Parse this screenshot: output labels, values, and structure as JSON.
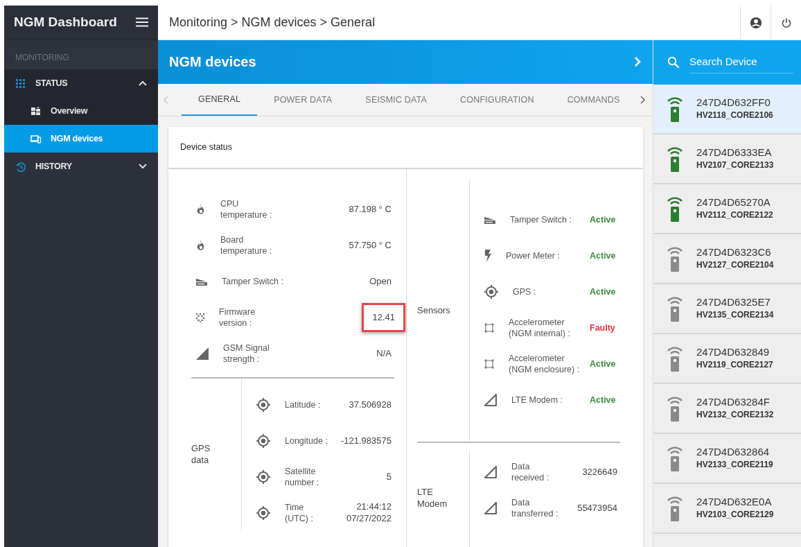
{
  "sidebar": {
    "title": "NGM Dashboard",
    "section": "MONITORING",
    "items": [
      {
        "label": "STATUS",
        "expanded": true,
        "children": [
          {
            "label": "Overview",
            "selected": false
          },
          {
            "label": "NGM devices",
            "selected": true
          }
        ]
      },
      {
        "label": "HISTORY",
        "expanded": false
      }
    ]
  },
  "breadcrumb": "Monitoring > NGM devices > General",
  "page_title": "NGM devices",
  "tabs": [
    {
      "label": "GENERAL",
      "selected": true
    },
    {
      "label": "POWER DATA",
      "selected": false
    },
    {
      "label": "SEISMIC DATA",
      "selected": false
    },
    {
      "label": "CONFIGURATION",
      "selected": false
    },
    {
      "label": "COMMANDS",
      "selected": false
    }
  ],
  "device_status": {
    "title": "Device status",
    "items": [
      {
        "label": "CPU\ntemperature :",
        "value": "87.198 ° C",
        "highlighted": false
      },
      {
        "label": "Board\ntemperature :",
        "value": "57.750 ° C",
        "highlighted": false
      },
      {
        "label": "Tamper Switch :",
        "value": "Open",
        "highlighted": false
      },
      {
        "label": "Firmware\nversion :",
        "value": "12.41",
        "highlighted": true
      },
      {
        "label": "GSM Signal\nstrength :",
        "value": "N/A",
        "highlighted": false
      }
    ],
    "gps": {
      "title": "GPS\ndata",
      "items": [
        {
          "label": "Latitude :",
          "value": "37.506928"
        },
        {
          "label": "Longitude :",
          "value": "-121.983575"
        },
        {
          "label": "Satellite\nnumber :",
          "value": "5"
        },
        {
          "label": "Time\n(UTC) :",
          "value": "21:44:12\n07/27/2022"
        }
      ]
    },
    "sensors": {
      "title": "Sensors",
      "items": [
        {
          "label": "Tamper Switch :",
          "value": "Active",
          "ok": true
        },
        {
          "label": "Power Meter :",
          "value": "Active",
          "ok": true
        },
        {
          "label": "GPS :",
          "value": "Active",
          "ok": true
        },
        {
          "label": "Accelerometer\n(NGM internal) :",
          "value": "Faulty",
          "ok": false
        },
        {
          "label": "Accelerometer\n(NGM enclosure) :",
          "value": "Active",
          "ok": true
        },
        {
          "label": "LTE Modem :",
          "value": "Active",
          "ok": true
        }
      ]
    },
    "lte": {
      "title": "LTE\nModem",
      "items": [
        {
          "label": "Data\nreceived :",
          "value": "3226649"
        },
        {
          "label": "Data\ntransferred :",
          "value": "55473954"
        }
      ]
    }
  },
  "search": {
    "placeholder": "Search Device"
  },
  "devices": [
    {
      "id": "247D4D632FF0",
      "name": "HV2118_CORE2106",
      "online": true,
      "selected": true
    },
    {
      "id": "247D4D6333EA",
      "name": "HV2107_CORE2133",
      "online": true,
      "selected": false
    },
    {
      "id": "247D4D65270A",
      "name": "HV2112_CORE2122",
      "online": true,
      "selected": false
    },
    {
      "id": "247D4D6323C6",
      "name": "HV2127_CORE2104",
      "online": false,
      "selected": false
    },
    {
      "id": "247D4D6325E7",
      "name": "HV2135_CORE2134",
      "online": false,
      "selected": false
    },
    {
      "id": "247D4D632849",
      "name": "HV2119_CORE2127",
      "online": false,
      "selected": false
    },
    {
      "id": "247D4D63284F",
      "name": "HV2132_CORE2132",
      "online": false,
      "selected": false
    },
    {
      "id": "247D4D632864",
      "name": "HV2133_CORE2119",
      "online": false,
      "selected": false
    },
    {
      "id": "247D4D632E0A",
      "name": "HV2103_CORE2129",
      "online": false,
      "selected": false
    }
  ]
}
